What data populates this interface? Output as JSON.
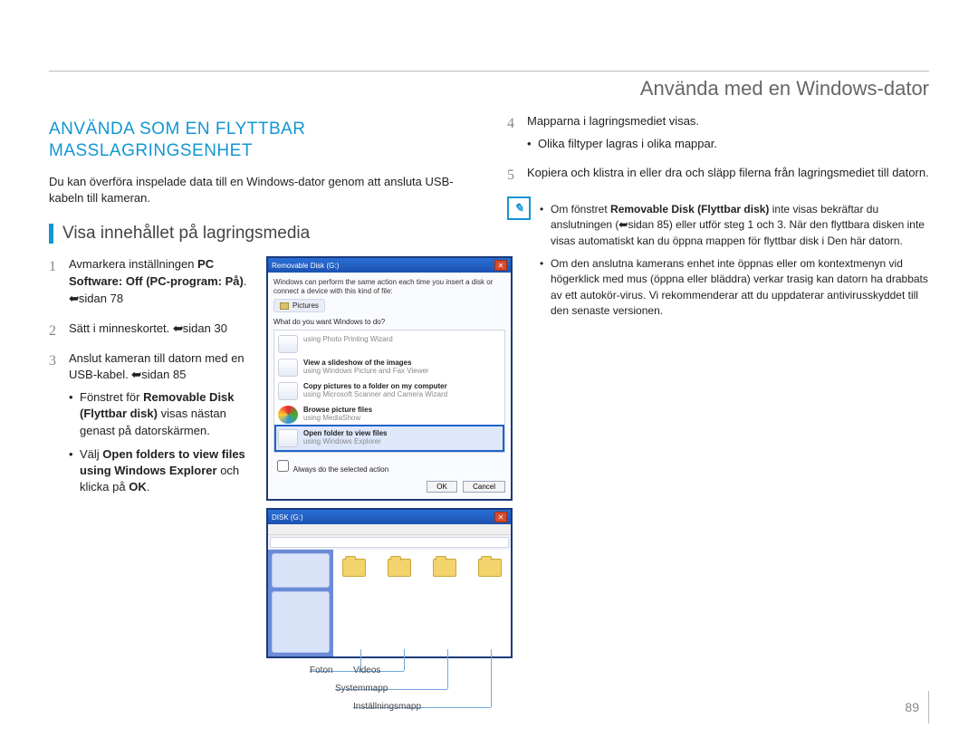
{
  "chapter_title": "Använda med en Windows-dator",
  "section_heading": "ANVÄNDA SOM EN FLYTTBAR MASSLAGRINGSENHET",
  "intro": "Du kan överföra inspelade data till en Windows-dator genom att ansluta USB-kabeln till kameran.",
  "subheading": "Visa innehållet på lagringsmedia",
  "steps_left": {
    "s1": {
      "pre": "Avmarkera inställningen ",
      "b1": "PC Software: Off (PC-program: På)",
      "post": ". ",
      "ref": "sidan 78"
    },
    "s2": {
      "pre": "Sätt i minneskortet. ",
      "ref": "sidan 30"
    },
    "s3": {
      "pre": "Anslut kameran till datorn med en USB-kabel. ",
      "ref": "sidan 85",
      "bul1": {
        "a": "Fönstret för ",
        "b": "Removable Disk (Flyttbar disk)",
        "c": " visas nästan genast på datorskärmen."
      },
      "bul2": {
        "a": "Välj ",
        "b": "Open folders to view files using Windows Explorer",
        "c": " och klicka på ",
        "d": "OK",
        "e": "."
      }
    }
  },
  "steps_right": {
    "s4": {
      "line1": "Mapparna i lagringsmediet visas.",
      "bul": "Olika filtyper lagras i olika mappar."
    },
    "s5": "Kopiera och klistra in eller dra och släpp filerna från lagringsmediet till datorn."
  },
  "note": {
    "b1": {
      "a": "Om fönstret ",
      "b": "Removable Disk (Flyttbar disk)",
      "c": " inte visas bekräftar du anslutningen (",
      "ref": "sidan 85",
      "d": ") eller utför steg 1 och 3. När den flyttbara disken inte visas automatiskt kan du öppna mappen för flyttbar disk i Den här datorn."
    },
    "b2": "Om den anslutna kamerans enhet inte öppnas eller om kontextmenyn vid högerklick med mus (öppna eller bläddra) verkar trasig kan datorn ha drabbats av ett autokör-virus. Vi rekommenderar att du uppdaterar antivirusskyddet till den senaste versionen."
  },
  "dialog1": {
    "title": "Removable Disk (G:)",
    "line1": "Windows can perform the same action each time you insert a disk or connect a device with this kind of file:",
    "pictures": "Pictures",
    "question": "What do you want Windows to do?",
    "opt1_t": "using Photo Printing Wizard",
    "opt2_a": "View a slideshow of the images",
    "opt2_b": "using Windows Picture and Fax Viewer",
    "opt3_a": "Copy pictures to a folder on my computer",
    "opt3_b": "using Microsoft Scanner and Camera Wizard",
    "opt4_a": "Browse picture files",
    "opt4_b": "using MediaShow",
    "opt5_a": "Open folder to view files",
    "opt5_b": "using Windows Explorer",
    "always": "Always do the selected action",
    "ok": "OK",
    "cancel": "Cancel"
  },
  "dialog2": {
    "title": "DISK (G:)",
    "folders": [
      "",
      "",
      "",
      ""
    ]
  },
  "callouts": {
    "foton": "Foton",
    "videos": "Videos",
    "sysmap": "Systemmapp",
    "instmap": "Inställningsmapp"
  },
  "page_number": "89"
}
